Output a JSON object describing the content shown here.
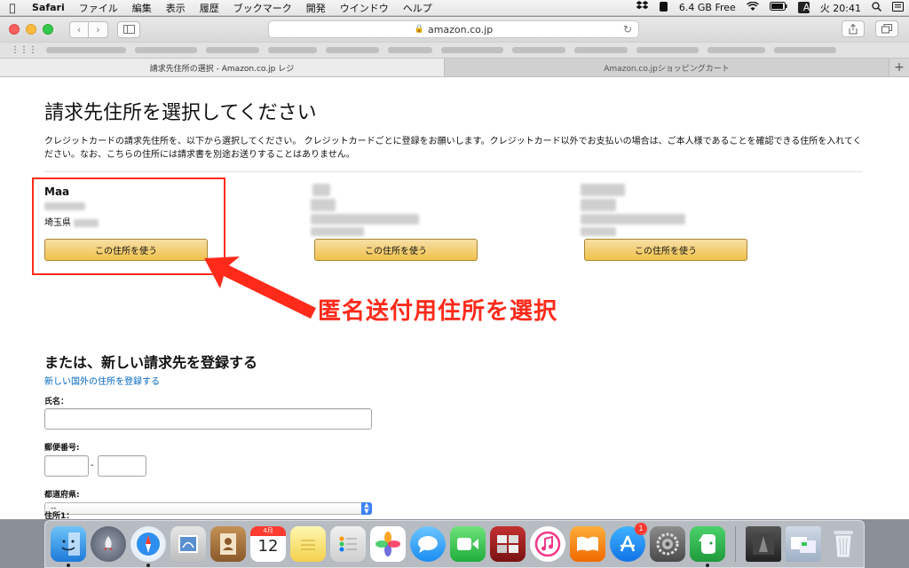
{
  "menubar": {
    "app": "Safari",
    "items": [
      "ファイル",
      "編集",
      "表示",
      "履歴",
      "ブックマーク",
      "開発",
      "ウインドウ",
      "ヘルプ"
    ],
    "memory": "6.4 GB Free",
    "input_mode": "A",
    "clock": "火 20:41"
  },
  "browser": {
    "url": "amazon.co.jp",
    "tabs": [
      {
        "label": "請求先住所の選択 - Amazon.co.jp レジ",
        "active": true
      },
      {
        "label": "Amazon.co.jpショッピングカート",
        "active": false
      }
    ]
  },
  "page": {
    "title": "請求先住所を選択してください",
    "description": "クレジットカードの請求先住所を、以下から選択してください。 クレジットカードごとに登録をお願いします。クレジットカード以外でお支払いの場合は、ご本人様であることを確認できる住所を入れてください。なお、こちらの住所には請求書を別途お送りすることはありません。",
    "addresses": [
      {
        "name": "Maa",
        "prefecture": "埼玉県",
        "button": "この住所を使う"
      },
      {
        "button": "この住所を使う"
      },
      {
        "button": "この住所を使う"
      }
    ],
    "annotation": "匿名送付用住所を選択",
    "new_section_title": "または、新しい請求先を登録する",
    "foreign_link": "新しい国外の住所を登録する",
    "form": {
      "name_label": "氏名：",
      "postal_label": "郵便番号:",
      "postal_dash": "-",
      "prefecture_label": "都道府県:",
      "prefecture_value": "--",
      "address1_label": "住所1："
    }
  },
  "dock": {
    "calendar_month": "4月",
    "calendar_day": "12",
    "appstore_badge": "1"
  },
  "colors": {
    "button_yellow": "#f0c14b",
    "annotation_red": "#ff2a1a",
    "link_blue": "#0066c0"
  }
}
